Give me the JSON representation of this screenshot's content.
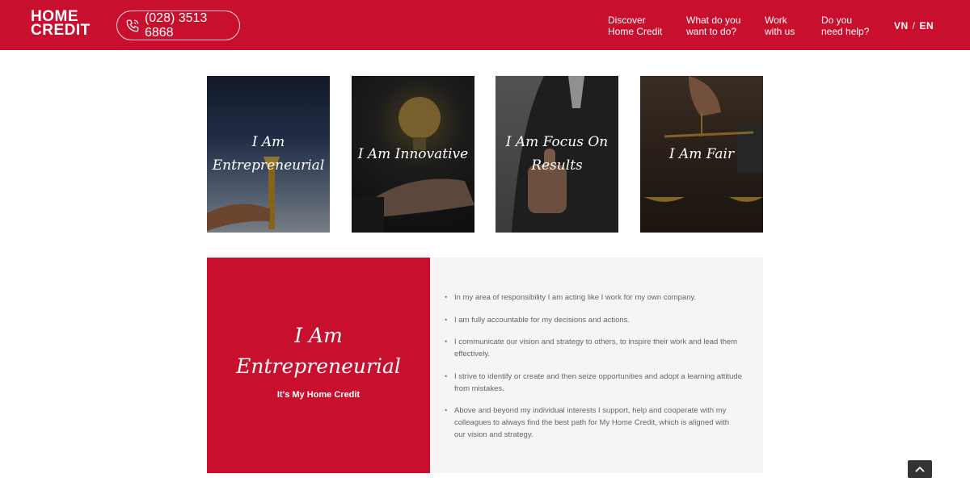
{
  "header": {
    "logo_line1": "HOME",
    "logo_line2": "CREDIT",
    "phone": "(028) 3513 6868",
    "nav": [
      {
        "line1": "Discover",
        "line2": "Home Credit"
      },
      {
        "line1": "What do you",
        "line2": "want to do?"
      },
      {
        "line1": "Work",
        "line2": "with us"
      },
      {
        "line1": "Do you",
        "line2": "need help?"
      }
    ],
    "lang_vn": "VN",
    "lang_sep": "/",
    "lang_en": "EN"
  },
  "cards": [
    {
      "line1": "I Am",
      "line2": "Entrepreneurial"
    },
    {
      "line1": "I Am Innovative",
      "line2": ""
    },
    {
      "line1": "I Am Focus On",
      "line2": "Results"
    },
    {
      "line1": "I Am Fair",
      "line2": ""
    }
  ],
  "detail": {
    "title_line1": "I Am",
    "title_line2": "Entrepreneurial",
    "subtitle": "It's My Home Credit",
    "bullets": [
      "In my area of responsibility I am acting like I work for my own company.",
      "I am fully accountable for my decisions and actions.",
      "I communicate our vision and strategy to others, to inspire their work and lead them effectively.",
      "I strive to identify or create and then seize opportunities and adopt a learning attitude from mistakes.",
      "Above and beyond my individual interests I support, help and cooperate with my colleagues to always find the best path for My Home Credit, which is aligned with our vision and strategy."
    ]
  },
  "icons": {
    "phone": "phone-icon",
    "to_top": "chevron-up-icon"
  },
  "colors": {
    "brand_red": "#c8102e",
    "panel_grey": "#f5f5f5"
  }
}
